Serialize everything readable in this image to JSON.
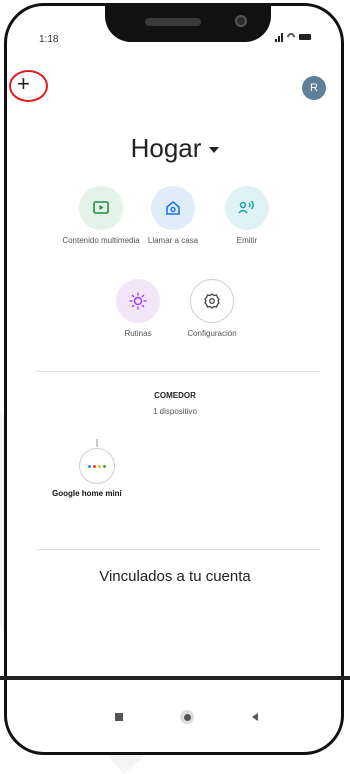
{
  "status_bar": {
    "time": "1:18"
  },
  "header": {
    "add_label": "+",
    "avatar_initial": "R"
  },
  "home": {
    "title": "Hogar"
  },
  "actions": [
    {
      "label": "Contenido multimedia"
    },
    {
      "label": "Llamar a casa"
    },
    {
      "label": "Emitir"
    },
    {
      "label": "Rutinas"
    },
    {
      "label": "Configuración"
    }
  ],
  "room": {
    "name": "COMEDOR",
    "device_count": "1 dispositivo"
  },
  "device": {
    "name": "Google home mini"
  },
  "linked": {
    "title": "Vinculados a tu cuenta"
  },
  "colors": {
    "media_bg": "#e3f3ea",
    "media_icon": "#1e8e3e",
    "call_bg": "#e1ecfb",
    "call_icon": "#1a73e8",
    "cast_bg": "#dff3f5",
    "cast_icon": "#12a4af",
    "routines_bg": "#f3e5f8",
    "routines_icon": "#a142f4",
    "settings_icon": "#444444",
    "highlight": "#e02020"
  },
  "icons": [
    "plus-icon",
    "avatar",
    "media-icon",
    "call-home-icon",
    "cast-icon",
    "routines-icon",
    "settings-gear-icon",
    "google-home-mini-icon"
  ]
}
